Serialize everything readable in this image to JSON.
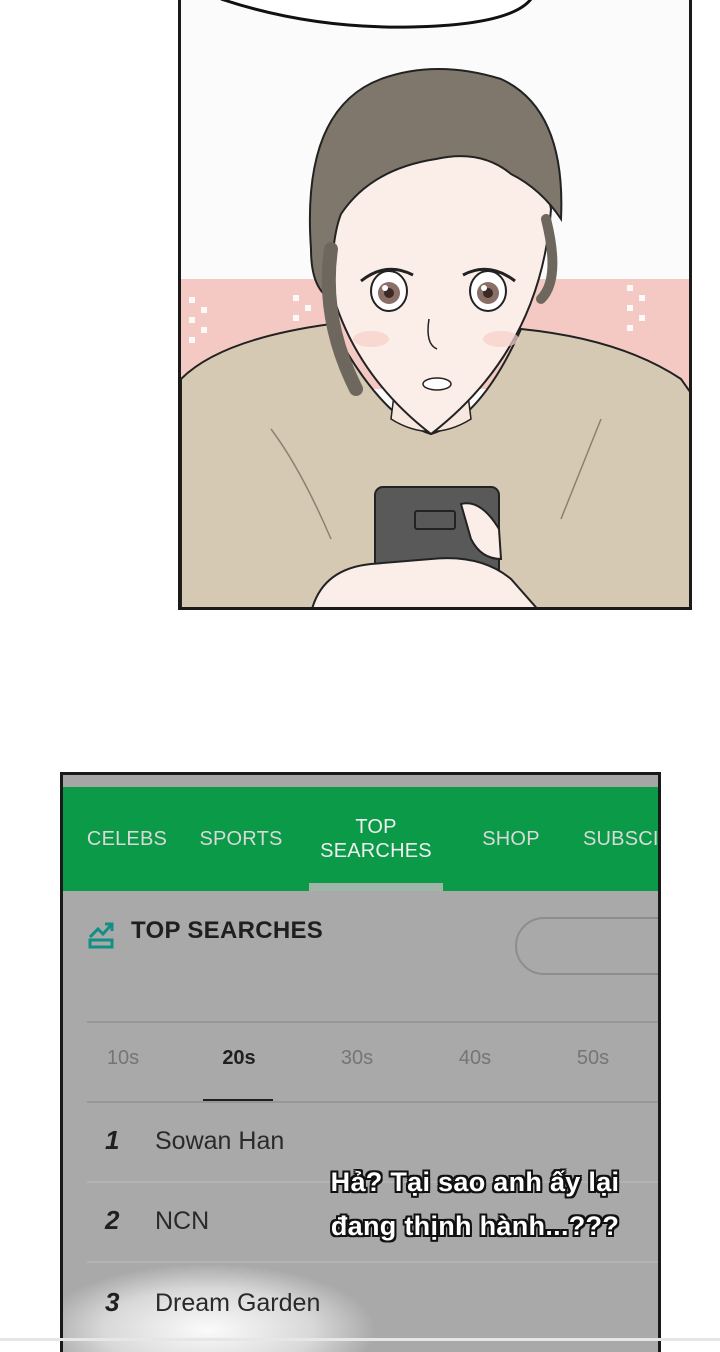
{
  "nav": {
    "tabs": [
      {
        "label": "CELEBS"
      },
      {
        "label": "SPORTS"
      },
      {
        "label": "TOP\nSEARCHES",
        "active": true
      },
      {
        "label": "SHOP"
      },
      {
        "label": "SUBSCI"
      }
    ],
    "accent_color": "#0a9a48"
  },
  "section": {
    "title": "TOP SEARCHES",
    "icon": "trending-chart-icon"
  },
  "age_filters": [
    {
      "label": "10s"
    },
    {
      "label": "20s",
      "active": true
    },
    {
      "label": "30s"
    },
    {
      "label": "40s"
    },
    {
      "label": "50s"
    }
  ],
  "rankings": [
    {
      "rank": "1",
      "name": "Sowan Han"
    },
    {
      "rank": "2",
      "name": "NCN"
    },
    {
      "rank": "3",
      "name": "Dream Garden"
    }
  ],
  "dialogue": {
    "line1": "Hả? Tại sao anh ấy lại",
    "line2": "đang thịnh hành...???"
  }
}
